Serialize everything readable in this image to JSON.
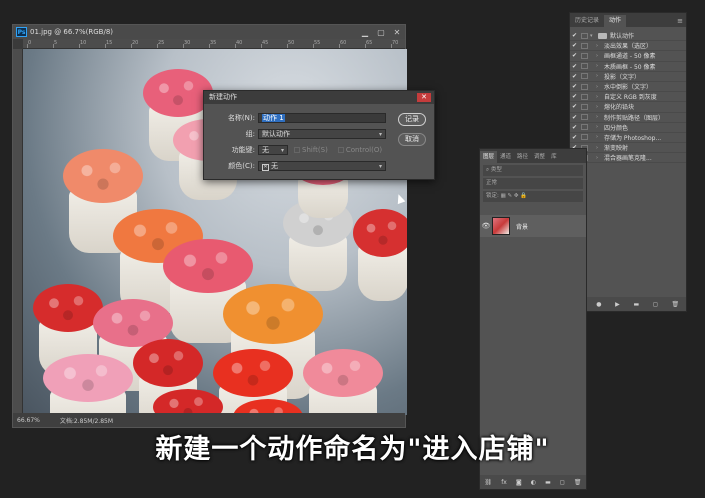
{
  "document": {
    "title": "01.jpg @ 66.7%(RGB/8)",
    "zoom": "66.67%",
    "doc_size": "文档:2.85M/2.85M",
    "ruler_ticks": [
      "0",
      "5",
      "10",
      "15",
      "20",
      "25",
      "30",
      "35",
      "40",
      "45",
      "50",
      "55",
      "60",
      "65",
      "70"
    ]
  },
  "dialog": {
    "title": "新建动作",
    "name_label": "名称(N):",
    "name_value": "动作 1",
    "group_label": "组:",
    "group_value": "默认动作",
    "fkey_label": "功能键:",
    "fkey_value": "无",
    "shift_label": "Shift(S)",
    "control_label": "Control(O)",
    "color_label": "颜色(C):",
    "color_value": "无",
    "record_button": "记录",
    "cancel_button": "取消"
  },
  "actions_panel": {
    "tabs": [
      "历史记录",
      "动作"
    ],
    "active_tab": 1,
    "items": [
      {
        "label": "默认动作",
        "folder": true
      },
      {
        "label": "淡出效果（选区）"
      },
      {
        "label": "画框通道 - 50 像素"
      },
      {
        "label": "木质画框 - 50 像素"
      },
      {
        "label": "投影（文字）"
      },
      {
        "label": "水中倒影（文字）"
      },
      {
        "label": "自定义 RGB 到灰度"
      },
      {
        "label": "熔化的铅块"
      },
      {
        "label": "制作剪贴路径（图层）"
      },
      {
        "label": "四分颜色"
      },
      {
        "label": "存储为 Photoshop..."
      },
      {
        "label": "渐变映射"
      },
      {
        "label": "混合器画笔克隆..."
      }
    ]
  },
  "layers_panel": {
    "tabs": [
      "图层",
      "通道",
      "路径",
      "调整",
      "库"
    ],
    "kind_label": "类型",
    "blend_mode": "正常",
    "lock_label": "锁定:",
    "layer_name": "背景"
  },
  "subtitle": "新建一个动作命名为\"进入店铺\""
}
